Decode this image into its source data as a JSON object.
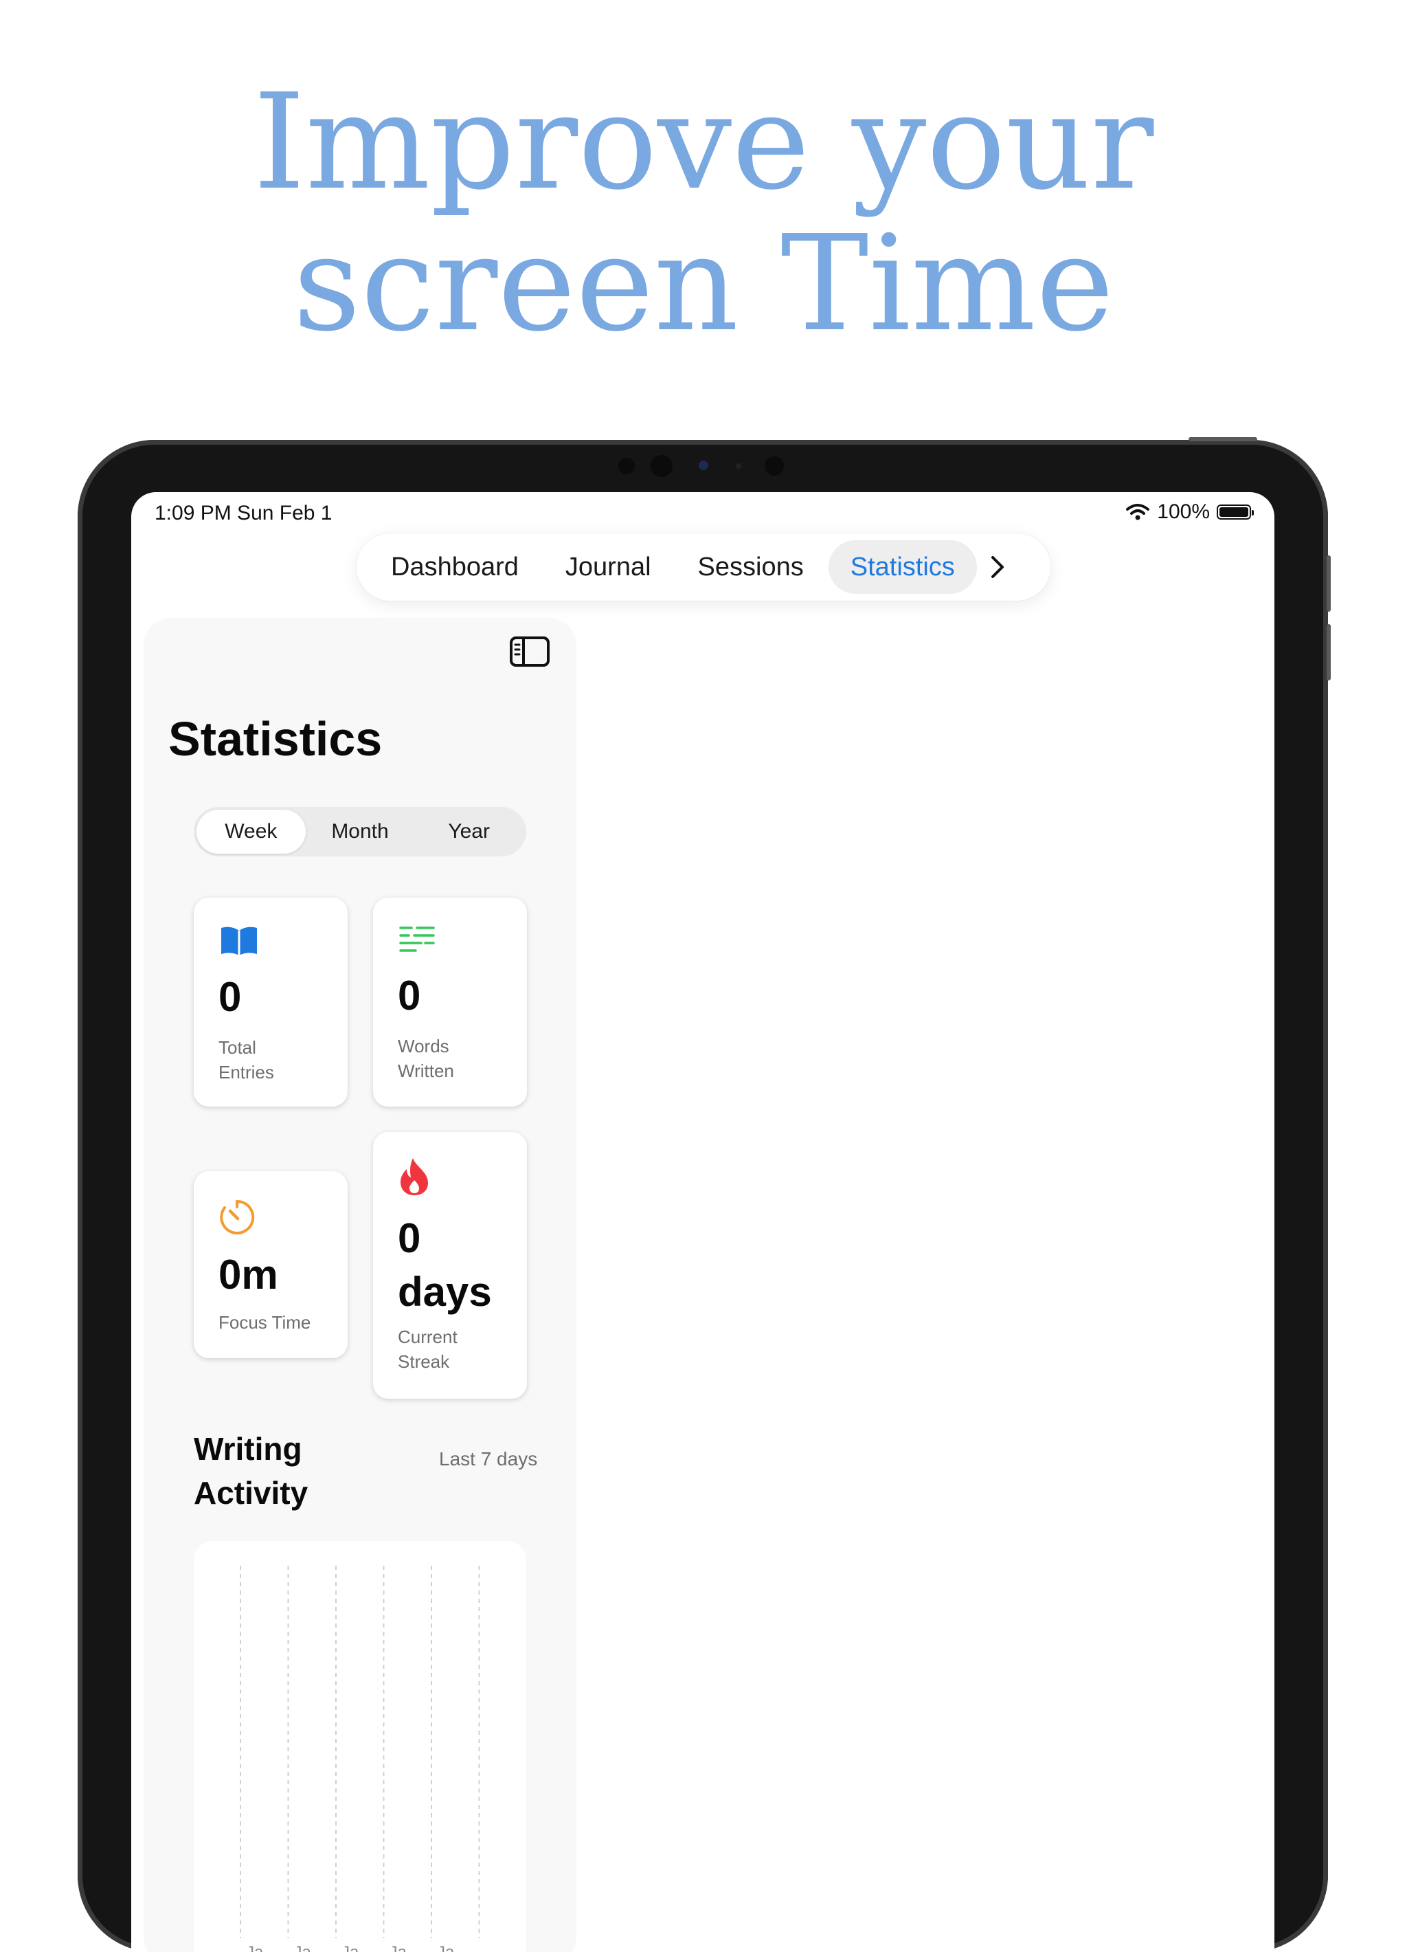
{
  "headline": {
    "line1": "Improve  your",
    "line2": "screen Time"
  },
  "status_bar": {
    "time": "1:09 PM   Sun Feb 1",
    "battery": "100%"
  },
  "tabs": [
    {
      "label": "Dashboard",
      "active": false
    },
    {
      "label": "Journal",
      "active": false
    },
    {
      "label": "Sessions",
      "active": false
    },
    {
      "label": "Statistics",
      "active": true
    }
  ],
  "sidebar": {
    "title": "Statistics",
    "ranges": [
      {
        "label": "Week",
        "active": true
      },
      {
        "label": "Month",
        "active": false
      },
      {
        "label": "Year",
        "active": false
      }
    ],
    "stats": {
      "entries": {
        "value": "0",
        "label": "Total Entries",
        "icon": "book-icon",
        "color": "#1f7ae0"
      },
      "words": {
        "value": "0",
        "label": "Words Written",
        "icon": "text-lines-icon",
        "color": "#34c759"
      },
      "focus": {
        "value": "0m",
        "label": "Focus Time",
        "icon": "timer-icon",
        "color": "#f59a2f"
      },
      "streak": {
        "value": "0 days",
        "label": "Current Streak",
        "icon": "flame-icon",
        "color": "#f0353f"
      }
    },
    "activity": {
      "title": "Writing Activity",
      "period": "Last 7 days"
    }
  },
  "chart_data": {
    "type": "bar",
    "categories": [
      "Ja...",
      "Ja...",
      "Ja...",
      "Ja...",
      "Ja...",
      "..."
    ],
    "values": [
      0,
      0,
      0,
      0,
      0,
      0
    ],
    "title": "Writing Activity",
    "grid": true
  }
}
